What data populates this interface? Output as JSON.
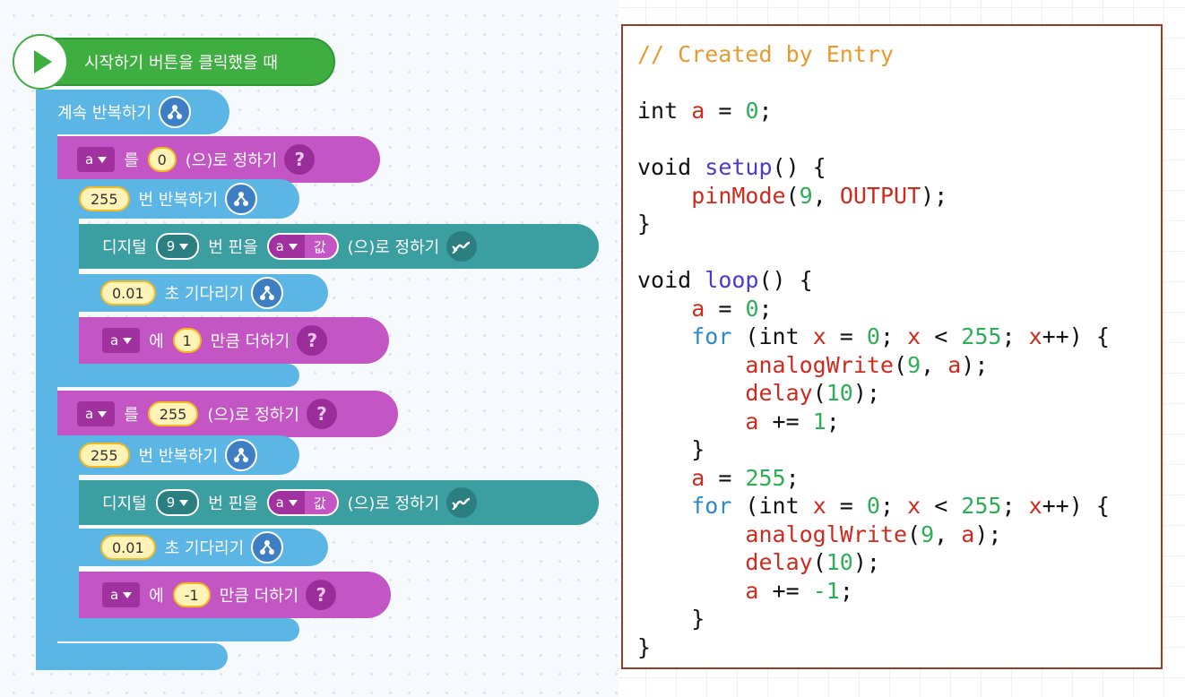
{
  "blocks": {
    "start": "시작하기 버튼을 클릭했을 때",
    "forever": "계속 반복하기",
    "repeat_label": "번 반복하기",
    "repeat_count": "255",
    "set_var": "a",
    "set_word": "를",
    "set_suffix": "(으)로 정하기",
    "set_value_1": "0",
    "set_value_2": "255",
    "digital": "디지털",
    "pin": "9",
    "pin_word": "번 핀을",
    "value_word": "값",
    "wait_time": "0.01",
    "wait_label": "초 기다리기",
    "add_word": "에",
    "add_suffix": "만큼 더하기",
    "add_value_1": "1",
    "add_value_2": "-1",
    "question": "?"
  },
  "code": {
    "comment": "// Created by Entry",
    "lines": [
      "// Created by Entry",
      "",
      "int a = 0;",
      "",
      "void setup() {",
      "    pinMode(9, OUTPUT);",
      "}",
      "",
      "void loop() {",
      "    a = 0;",
      "    for (int x = 0; x < 255; x++) {",
      "        analogWrite(9, a);",
      "        delay(10);",
      "        a += 1;",
      "    }",
      "    a = 255;",
      "    for (int x = 0; x < 255; x++) {",
      "        analoglWrite(9, a);",
      "        delay(10);",
      "        a += -1;",
      "    }",
      "}"
    ]
  },
  "colors": {
    "start_green": "#3fae41",
    "flow_blue": "#5cb6e5",
    "variable_magenta": "#c455c5",
    "hardware_teal": "#3b9ea0",
    "code_border": "#9b3d25"
  },
  "icons": [
    "play-icon",
    "flow-icon",
    "question-icon",
    "hardware-link-icon",
    "dropdown-caret-icon"
  ]
}
